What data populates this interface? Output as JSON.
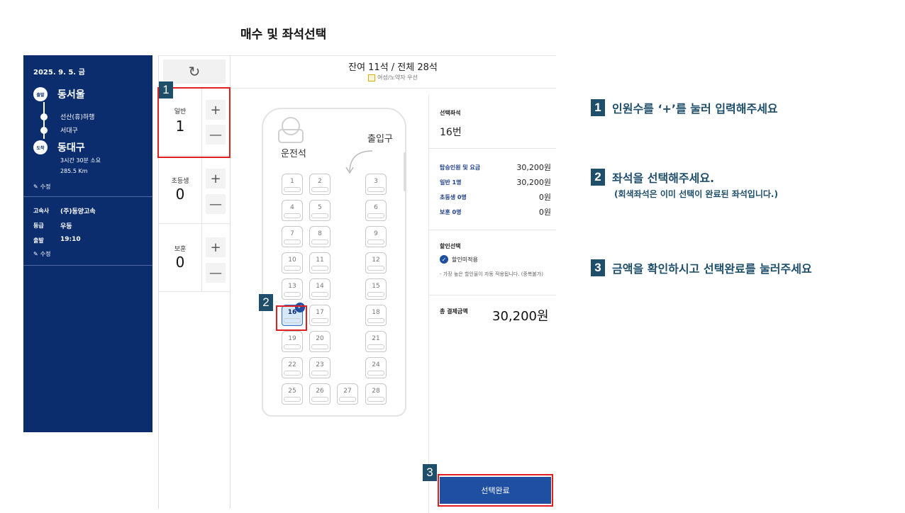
{
  "page_title": "매수 및 좌석선택",
  "trip": {
    "date": "2025. 9. 5. 금",
    "departure_badge": "출발",
    "departure": "동서울",
    "stops": [
      "선산(휴)하행",
      "서대구"
    ],
    "arrival_badge": "도착",
    "arrival": "동대구",
    "duration": "3시간 30분 소요",
    "distance": "285.5 Km",
    "edit_label": "수정",
    "info": [
      {
        "key": "고속사",
        "value": "(주)동양고속"
      },
      {
        "key": "등급",
        "value": "우등"
      },
      {
        "key": "출발",
        "value": "19:10"
      }
    ]
  },
  "passengers": [
    {
      "label": "일반",
      "count": "1"
    },
    {
      "label": "초등생",
      "count": "0"
    },
    {
      "label": "보훈",
      "count": "0"
    }
  ],
  "plus_symbol": "+",
  "minus_symbol": "—",
  "refresh_symbol": "↻",
  "seat_summary": "잔여 11석 / 전체 28석",
  "priority_legend": "여성/노약자 우선",
  "bus": {
    "driver_label": "운전석",
    "entrance_label": "출입구",
    "seats": [
      "1",
      "2",
      "3",
      "4",
      "5",
      "6",
      "7",
      "8",
      "9",
      "10",
      "11",
      "12",
      "13",
      "14",
      "15",
      "16",
      "17",
      "18",
      "19",
      "20",
      "21",
      "22",
      "23",
      "24",
      "25",
      "26",
      "27",
      "28"
    ],
    "selected_seat": "16"
  },
  "summary": {
    "selected_seat_title": "선택좌석",
    "selected_seat_value": "16번",
    "fares": [
      {
        "label": "탑승인원 및 요금",
        "amount": "30,200원"
      },
      {
        "label": "일반 1명",
        "amount": "30,200원"
      },
      {
        "label": "초등생 0명",
        "amount": "0원"
      },
      {
        "label": "보훈 0명",
        "amount": "0원"
      }
    ],
    "discount_title": "할인선택",
    "discount_option": "할인미적용",
    "discount_note": "- 가장 높은 할인율이 자동 적용됩니다. (중복불가)",
    "total_label": "총 결제금액",
    "total_amount": "30,200원",
    "confirm_label": "선택완료"
  },
  "annotations": {
    "tags": [
      "1",
      "2",
      "3"
    ],
    "instructions": [
      {
        "num": "1",
        "text": "인원수를 ‘+’를 눌러 입력해주세요"
      },
      {
        "num": "2",
        "text": "좌석을 선택해주세요.",
        "sub": "(회색좌석은 이미 선택이 완료된 좌석입니다.)"
      },
      {
        "num": "3",
        "text": "금액을 확인하시고 선택완료를 눌러주세요"
      }
    ]
  },
  "colors": {
    "navy_panel": "#0b2d6e",
    "primary_button": "#1e4fa1",
    "annotation_red": "#e0201e",
    "annotation_tag": "#1f4e6b"
  }
}
